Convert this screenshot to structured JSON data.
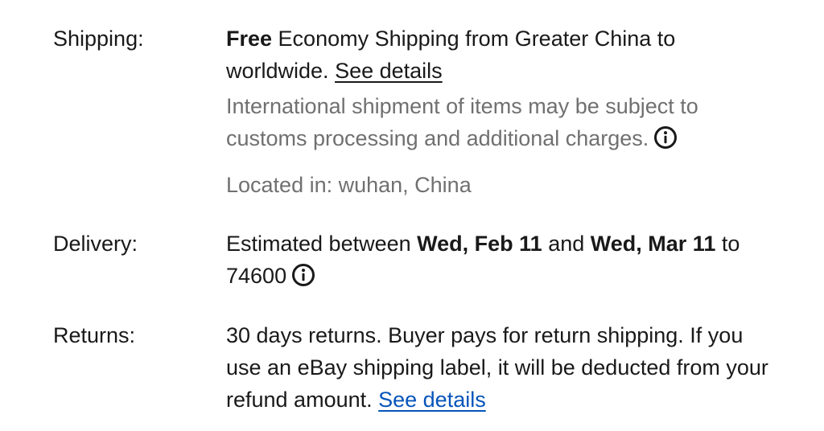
{
  "shipping": {
    "label": "Shipping:",
    "free": "Free",
    "method": " Economy Shipping from Greater China to worldwide. ",
    "details_link": "See details",
    "intl_note": "International shipment of items may be subject to customs processing and additional charges.",
    "location": "Located in: wuhan, China"
  },
  "delivery": {
    "label": "Delivery:",
    "prefix": "Estimated between ",
    "date_start": "Wed, Feb 11",
    "and": " and ",
    "date_end": "Wed, Mar 11",
    "to": " to 74600"
  },
  "returns": {
    "label": "Returns:",
    "text": "30 days returns. Buyer pays for return shipping. If you use an eBay shipping label, it will be deducted from your refund amount. ",
    "details_link": "See details"
  },
  "icons": {
    "info": "info-circle-icon"
  },
  "colors": {
    "text": "#191919",
    "muted": "#707070",
    "link": "#0654ba"
  }
}
